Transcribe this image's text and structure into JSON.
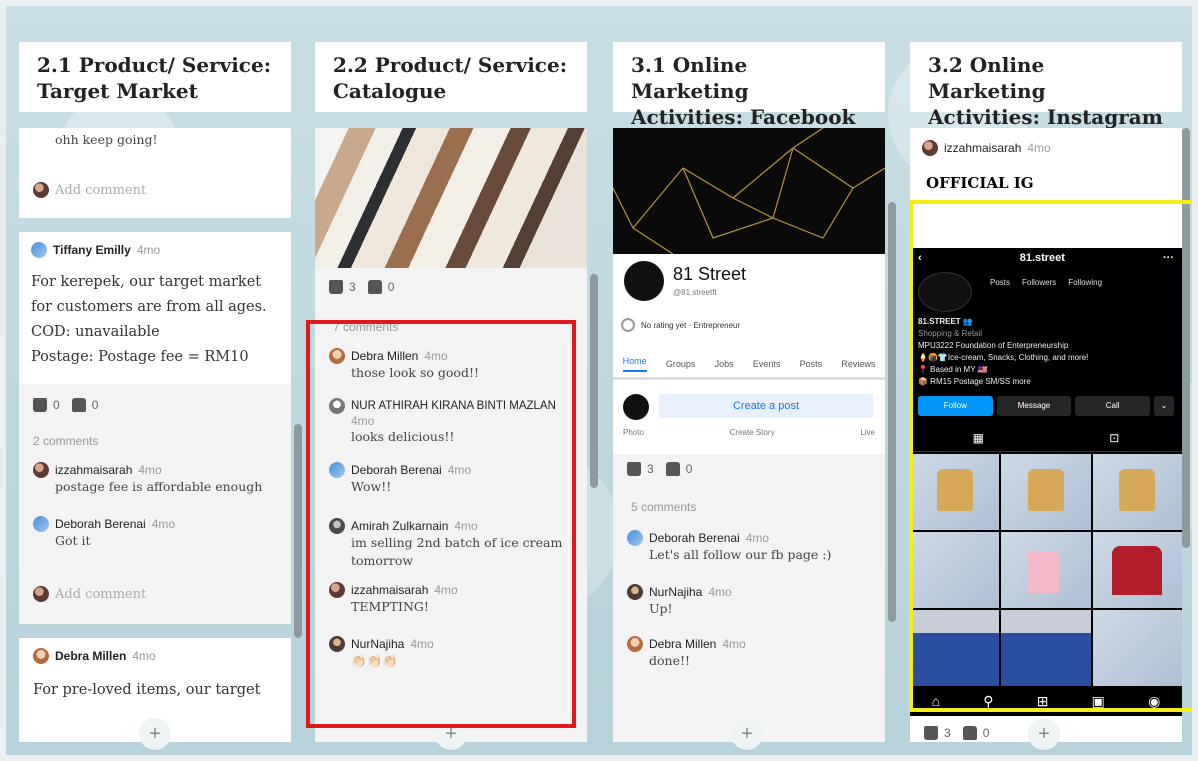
{
  "columns": [
    {
      "title": "2.1 Product/ Service: Target Market"
    },
    {
      "title": "2.2 Product/ Service: Catalogue"
    },
    {
      "title": "3.1 Online Marketing Activities: Facebook"
    },
    {
      "title": "3.2 Online Marketing Activities: Instagram"
    }
  ],
  "col1": {
    "prev_card": {
      "comment_text": "ohh keep going!",
      "add_comment": "Add comment"
    },
    "card2": {
      "author": "Tiffany Emilly",
      "time": "4mo",
      "lines": [
        "For kerepek, our target market",
        "for customers are from all ages.",
        "COD: unavailable",
        "Postage: Postage fee = RM10"
      ],
      "likes": "0",
      "dislikes": "0",
      "comments_count": "2 comments",
      "comments": [
        {
          "author": "izzahmaisarah",
          "time": "4mo",
          "text": "postage fee is affordable enough"
        },
        {
          "author": "Deborah Berenai",
          "time": "4mo",
          "text": "Got it"
        }
      ],
      "add_comment": "Add comment"
    },
    "card3": {
      "author": "Debra Millen",
      "time": "4mo",
      "text": "For pre-loved items, our target"
    }
  },
  "col2": {
    "likes": "3",
    "dislikes": "0",
    "comments_count": "7 comments",
    "comments": [
      {
        "author": "Debra Millen",
        "time": "4mo",
        "text": "those look so good!!"
      },
      {
        "author": "NUR ATHIRAH KIRANA BINTI MAZLAN",
        "time": "4mo",
        "text": "looks delicious!!"
      },
      {
        "author": "Deborah Berenai",
        "time": "4mo",
        "text": "Wow!!"
      },
      {
        "author": "Amirah Zulkarnain",
        "time": "4mo",
        "text": "im selling 2nd batch of ice cream tomorrow"
      },
      {
        "author": "izzahmaisarah",
        "time": "4mo",
        "text": "TEMPTING!"
      },
      {
        "author": "NurNajiha",
        "time": "4mo",
        "text": "👏🏻👏🏻👏🏻"
      }
    ]
  },
  "col3": {
    "fb": {
      "page_name": "81 Street",
      "handle": "@81.streetft",
      "rating": "No rating yet · Entrepreneur",
      "tabs": [
        "Home",
        "Groups",
        "Jobs",
        "Events",
        "Posts",
        "Reviews"
      ],
      "create_post": "Create a post",
      "actions": [
        "Photo",
        "Create Story",
        "Live"
      ]
    },
    "likes": "3",
    "dislikes": "0",
    "comments_count": "5 comments",
    "comments": [
      {
        "author": "Deborah Berenai",
        "time": "4mo",
        "text": "Let's all follow our fb page :)"
      },
      {
        "author": "NurNajiha",
        "time": "4mo",
        "text": "Up!"
      },
      {
        "author": "Debra Millen",
        "time": "4mo",
        "text": "done!!"
      }
    ]
  },
  "col4": {
    "author": "izzahmaisarah",
    "time": "4mo",
    "title": "OFFICIAL IG",
    "ig": {
      "username": "81.street",
      "stats": [
        "Posts",
        "Followers",
        "Following"
      ],
      "bio": [
        "81.STREET 👥",
        "Shopping & Retail",
        "MPU3222 Foundation of Enterpreneurship",
        "🍦🍘👕Ice-cream, Snacks, Clothing, and more!",
        "📍 Based in MY 🇲🇾",
        "📦 RM15 Postage SM/SS  more"
      ],
      "buttons": [
        "Follow",
        "Message",
        "Call"
      ]
    },
    "likes": "3",
    "dislikes": "0"
  },
  "plus": "+"
}
